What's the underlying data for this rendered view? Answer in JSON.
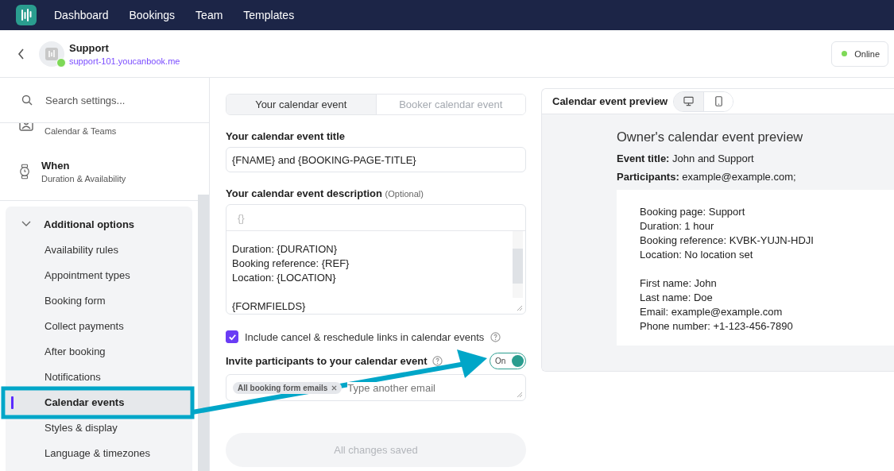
{
  "nav": {
    "items": [
      {
        "label": "Dashboard",
        "selected": false
      },
      {
        "label": "Bookings",
        "selected": false
      },
      {
        "label": "Team",
        "selected": false
      },
      {
        "label": "Templates",
        "selected": false
      }
    ]
  },
  "header": {
    "name": "Support",
    "url": "support-101.youcanbook.me",
    "online": true,
    "status": {
      "label": "Online",
      "color": "#7ed957"
    }
  },
  "sidebar": {
    "search": {
      "placeholder": "Search settings..."
    },
    "sections": [
      {
        "kind": "person",
        "subtitle": "Calendar & Teams"
      },
      {
        "kind": "watch",
        "title": "When",
        "subtitle": "Duration & Availability"
      }
    ],
    "group": {
      "title": "Additional options",
      "expanded": true,
      "items": [
        {
          "label": "Availability rules",
          "selected": false
        },
        {
          "label": "Appointment types",
          "selected": false
        },
        {
          "label": "Booking form",
          "selected": false
        },
        {
          "label": "Collect payments",
          "selected": false
        },
        {
          "label": "After booking",
          "selected": false
        },
        {
          "label": "Notifications",
          "selected": false
        },
        {
          "label": "Calendar events",
          "selected": true
        },
        {
          "label": "Styles & display",
          "selected": false
        },
        {
          "label": "Language & timezones",
          "selected": false
        }
      ]
    }
  },
  "main": {
    "tabs": [
      {
        "label": "Your calendar event",
        "selected": true
      },
      {
        "label": "Booker calendar event",
        "selected": false
      }
    ],
    "title_field": {
      "label": "Your calendar event title",
      "value": "{FNAME} and {BOOKING-PAGE-TITLE}"
    },
    "description": {
      "label": "Your calendar event description",
      "hint": "(Optional)",
      "toolbar": "{}",
      "blocks": [
        [
          "Duration: {DURATION}",
          "Booking reference: {REF}",
          "Location: {LOCATION}"
        ],
        [
          "{FORMFIELDS}"
        ]
      ]
    },
    "links_checkbox": {
      "label": "Include cancel & reschedule links in calendar events",
      "checked": true
    },
    "invite": {
      "label": "Invite participants to your calendar event",
      "toggle": {
        "label": "On",
        "on": true
      },
      "tags": [
        {
          "label": "All booking form emails"
        }
      ],
      "placeholder": "Type another email"
    },
    "save_button": {
      "label": "All changes saved",
      "disabled": true
    }
  },
  "preview": {
    "title": "Calendar event preview",
    "devices": [
      {
        "kind": "desktop",
        "selected": true
      },
      {
        "kind": "mobile",
        "selected": false
      }
    ],
    "heading": "Owner's calendar event preview",
    "event_title": {
      "label": "Event title:",
      "value": "John and Support"
    },
    "participants": {
      "label": "Participants:",
      "value": "example@example.com;"
    },
    "body": [
      [
        "Booking page: Support",
        "Duration: 1 hour",
        "Booking reference: KVBK-YUJN-HDJI",
        "Location: No location set"
      ],
      [
        "First name: John",
        "Last name: Doe",
        "Email: example@example.com",
        "Phone number: +1-123-456-7890"
      ]
    ]
  }
}
